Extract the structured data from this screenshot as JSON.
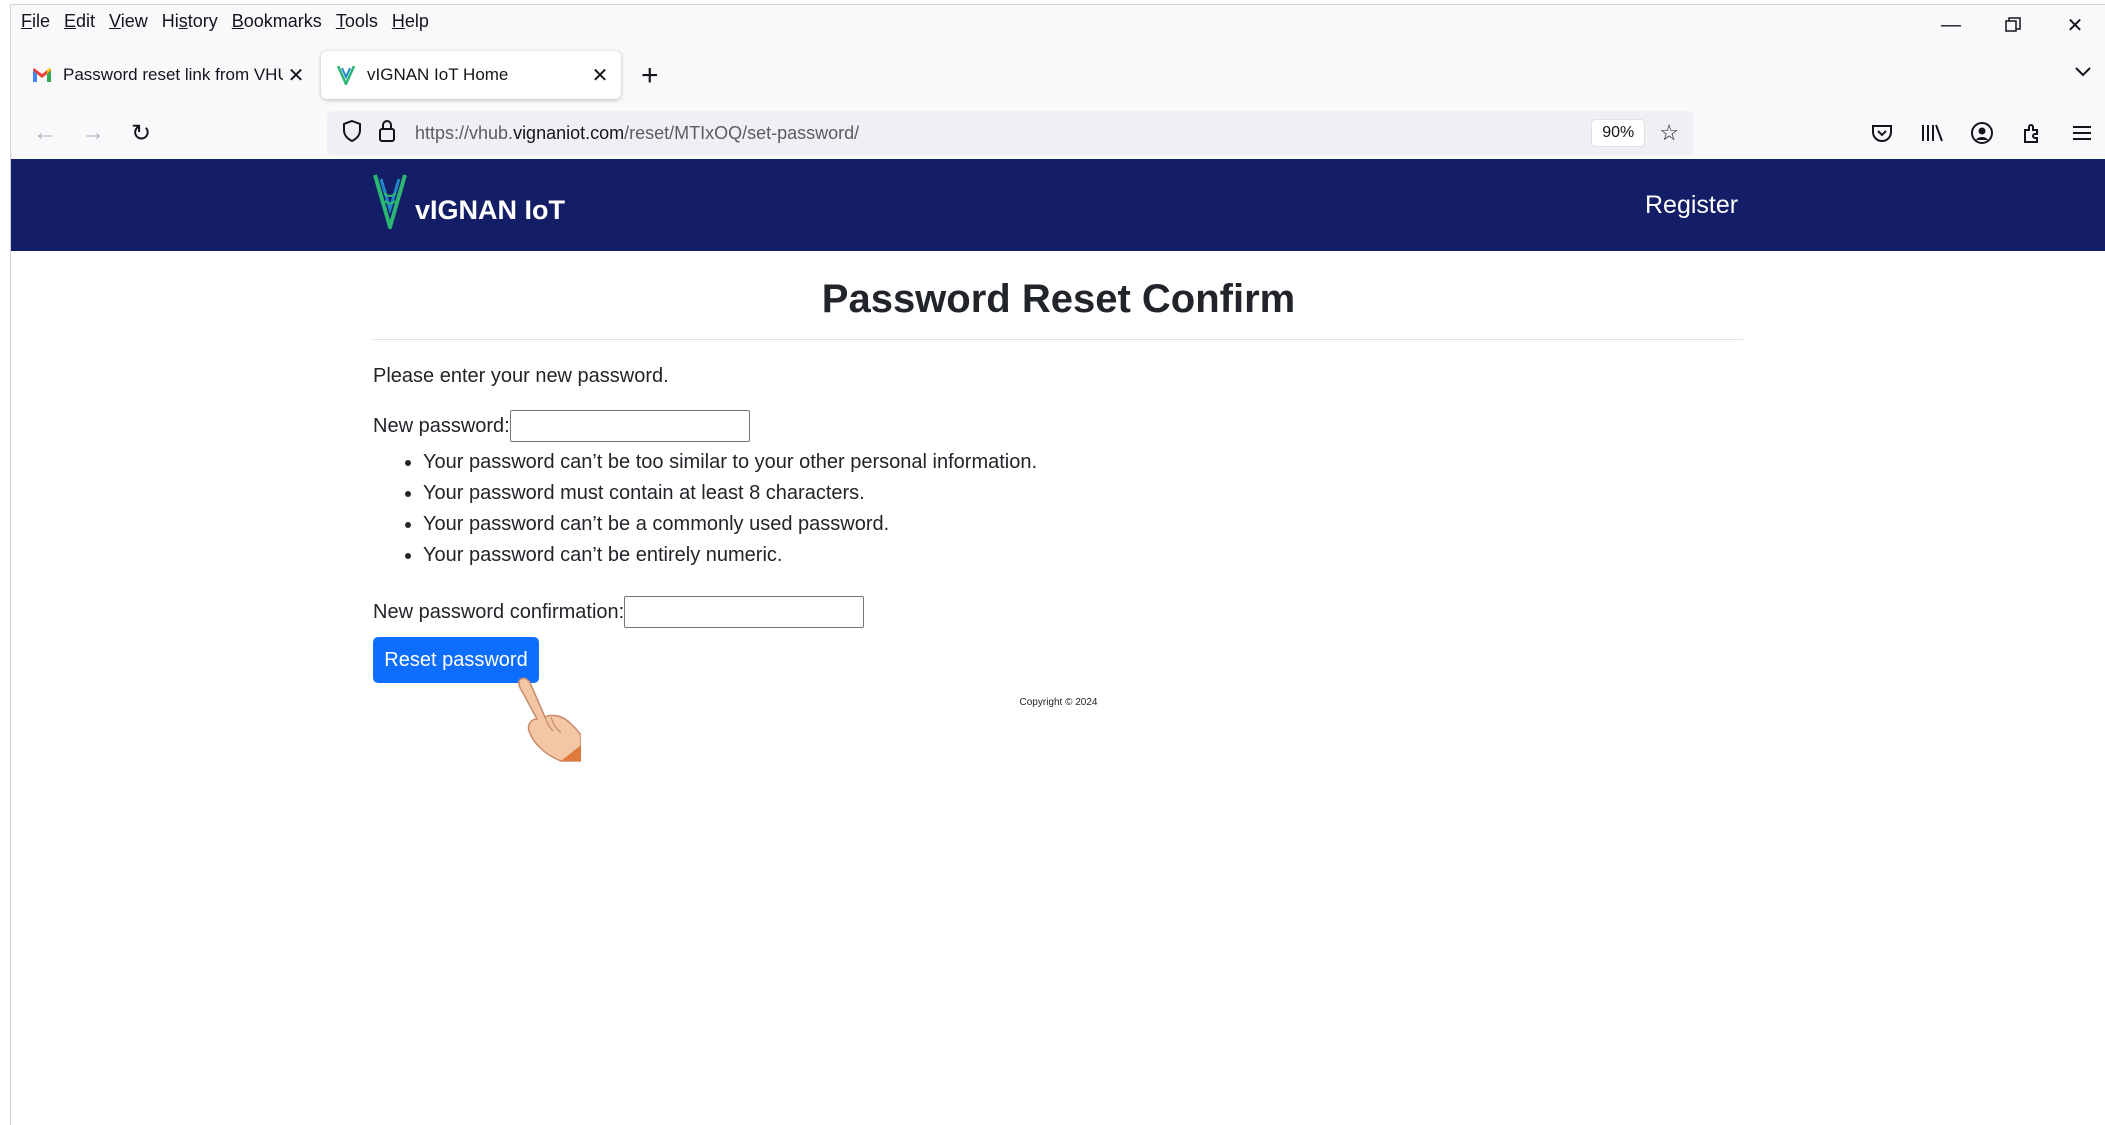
{
  "menu": [
    "File",
    "Edit",
    "View",
    "History",
    "Bookmarks",
    "Tools",
    "Help"
  ],
  "menu_underline": [
    "F",
    "E",
    "V",
    "s",
    "B",
    "T",
    "H"
  ],
  "tabs": [
    {
      "title": "Password reset link from VHUB.V",
      "icon": "gmail-icon",
      "active": false
    },
    {
      "title": "vIGNAN IoT Home",
      "icon": "vignan-logo-icon",
      "active": true
    }
  ],
  "urlbar": {
    "prefix": "https://vhub.",
    "domain": "vignaniot.com",
    "path": "/reset/MTIxOQ/set-password/",
    "zoom": "90%"
  },
  "site": {
    "brand": "vIGNAN IoT",
    "register": "Register",
    "heading": "Password Reset Confirm",
    "intro": "Please enter your new password.",
    "new_password_label": "New password:",
    "new_password_value": "",
    "rules": [
      "Your password can’t be too similar to your other personal information.",
      "Your password must contain at least 8 characters.",
      "Your password can’t be a commonly used password.",
      "Your password can’t be entirely numeric."
    ],
    "confirm_label": "New password confirmation:",
    "confirm_value": "",
    "submit": "Reset password",
    "copyright": "Copyright © 2024"
  },
  "colors": {
    "header_bg": "#141e66",
    "button_bg": "#0d6efd",
    "logo_green": "#2bb673"
  }
}
